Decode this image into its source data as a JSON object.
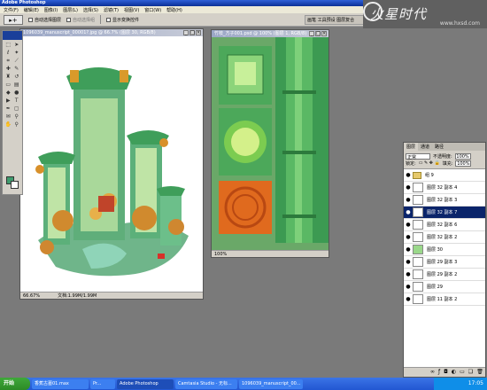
{
  "app": {
    "title": "Adobe Photoshop"
  },
  "menu": [
    "文件(F)",
    "编辑(E)",
    "图像(I)",
    "图层(L)",
    "选择(S)",
    "滤镜(T)",
    "视图(V)",
    "窗口(W)",
    "帮助(H)"
  ],
  "options": {
    "auto_select_layer": "自动选择图层",
    "auto_select_group": "自动选择组",
    "show_transform": "显示变换控件",
    "right_box": "画笔 工具预设 图层复合"
  },
  "brand": {
    "logo": "火星时代",
    "url": "www.hxsd.com"
  },
  "doc1": {
    "title": "1096039_manuscript_00001?.jpg @ 66.7% (图层 30, RGB/8)",
    "zoom": "66.67%",
    "info": "文档:1.99M/1.99M"
  },
  "doc2": {
    "title": "竹枝_方子001.psd @ 100% (图层 1, RGB/8)",
    "zoom": "100%"
  },
  "layers": {
    "tabs": [
      "图层",
      "通道",
      "路径"
    ],
    "blend": "正常",
    "opacity_label": "不透明度:",
    "opacity": "100%",
    "lock_label": "锁定:",
    "fill_label": "填充:",
    "fill": "100%",
    "items": [
      {
        "name": "组 9",
        "type": "group"
      },
      {
        "name": "图层 32 副本 4",
        "type": "layer"
      },
      {
        "name": "图层 32 副本 3",
        "type": "layer"
      },
      {
        "name": "图层 32 副本 7",
        "type": "layer",
        "selected": true
      },
      {
        "name": "图层 32 副本 6",
        "type": "layer"
      },
      {
        "name": "图层 32 副本 2",
        "type": "layer"
      },
      {
        "name": "图层 30",
        "type": "layer"
      },
      {
        "name": "图层 29 副本 3",
        "type": "layer"
      },
      {
        "name": "图层 29 副本 2",
        "type": "layer"
      },
      {
        "name": "图层 29",
        "type": "layer"
      },
      {
        "name": "图层 11 副本 2",
        "type": "layer"
      }
    ]
  },
  "taskbar": {
    "start": "开始",
    "items": [
      "香蕉古墓01.max",
      "Pr...",
      "Adobe Photoshop",
      "Camtasia Studio - 无标...",
      "1096039_manuscript_00..."
    ],
    "active_index": 2,
    "time": "17:05"
  }
}
